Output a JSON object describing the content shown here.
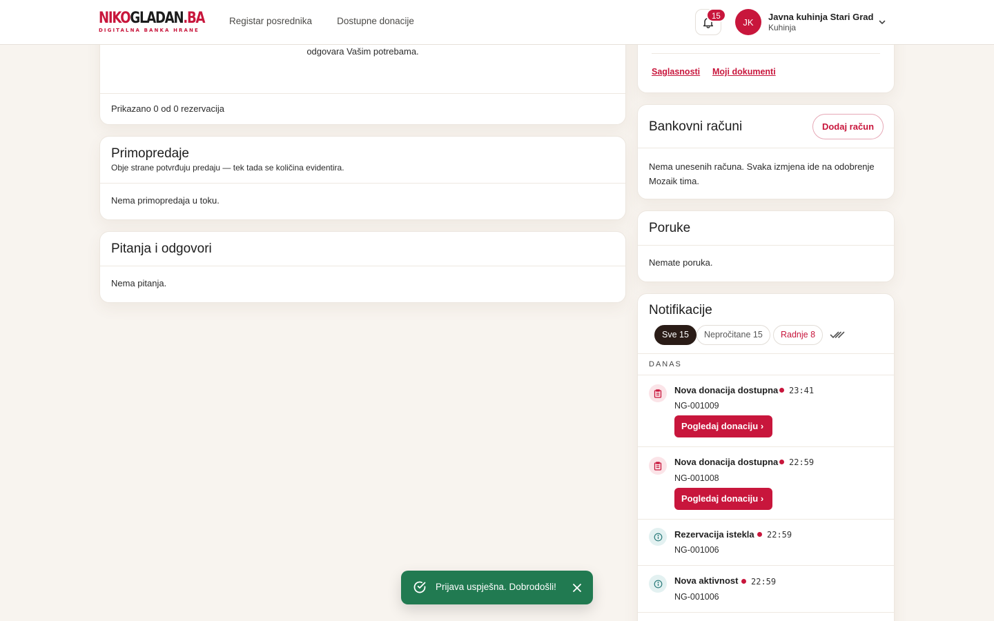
{
  "brand": {
    "name_red": "NIKO",
    "name_dark": "GLADAN",
    "name_dot": ".BA",
    "tagline": "DIGITALNA BANKA HRANE"
  },
  "nav": {
    "items": [
      {
        "label": "Registar posrednika"
      },
      {
        "label": "Dostupne donacije"
      }
    ]
  },
  "header": {
    "notification_count": "15",
    "avatar_initials": "JK",
    "user_name": "Javna kuhinja Stari Grad",
    "user_role": "Kuhinja"
  },
  "reservations": {
    "partial_text": "odgovara Vašim potrebama.",
    "footer": "Prikazano 0 od 0 rezervacija"
  },
  "handovers": {
    "title": "Primopredaje",
    "subtitle": "Obje strane potvrđuju predaju — tek tada se količina evidentira.",
    "empty": "Nema primopredaja u toku."
  },
  "qa": {
    "title": "Pitanja i odgovori",
    "empty": "Nema pitanja."
  },
  "documents": {
    "links": [
      {
        "label": "Saglasnosti"
      },
      {
        "label": "Moji dokumenti"
      }
    ]
  },
  "bank_accounts": {
    "title": "Bankovni računi",
    "add_button": "Dodaj račun",
    "empty": "Nema unesenih računa. Svaka izmjena ide na odobrenje Mozaik tima."
  },
  "messages": {
    "title": "Poruke",
    "empty": "Nemate poruka."
  },
  "notifications": {
    "title": "Notifikacije",
    "filters": [
      {
        "label": "Sve 15"
      },
      {
        "label": "Nepročitane 15"
      },
      {
        "label": "Radnje 8"
      }
    ],
    "group_label": "DANAS",
    "items": [
      {
        "icon": "clipboard-icon",
        "title": "Nova donacija dostupna",
        "time": "23:41",
        "id": "NG-001009",
        "action": "Pogledaj donaciju ›"
      },
      {
        "icon": "clipboard-icon",
        "title": "Nova donacija dostupna",
        "time": "22:59",
        "id": "NG-001008",
        "action": "Pogledaj donaciju ›"
      },
      {
        "icon": "info-icon",
        "title": "Rezervacija istekla",
        "time": "22:59",
        "id": "NG-001006"
      },
      {
        "icon": "info-icon",
        "title": "Nova aktivnost",
        "time": "22:59",
        "id": "NG-001006"
      }
    ]
  },
  "toast": {
    "message": "Prijava uspješna. Dobrodošli!"
  },
  "colors": {
    "accent": "#c8163c",
    "success": "#217a51",
    "background": "#f8f4ef"
  }
}
